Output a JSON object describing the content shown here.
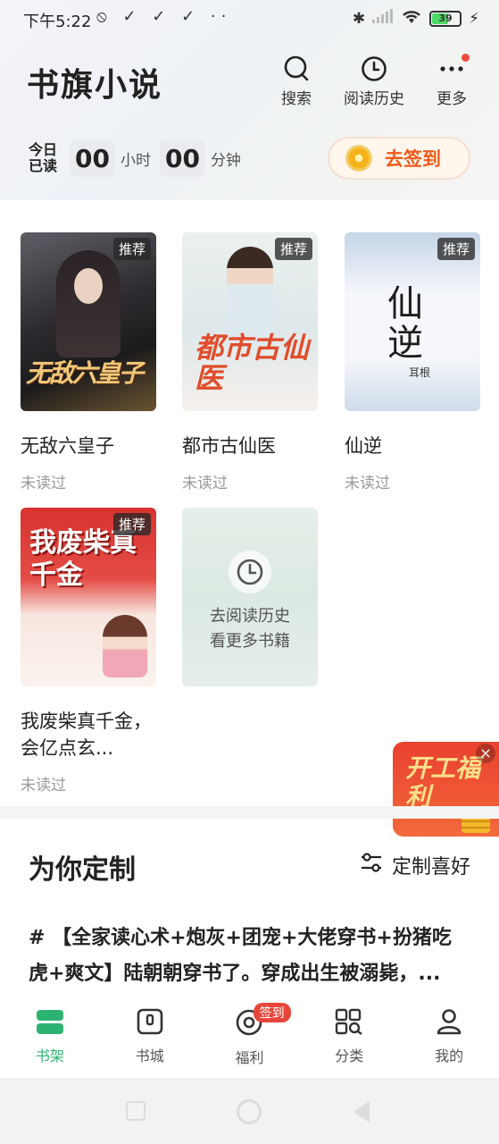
{
  "status_bar": {
    "time": "下午5:22",
    "left_icons": "⦸ ✓ ✓ ✓ ··",
    "battery": "39"
  },
  "header": {
    "app_title": "书旗小说",
    "actions": [
      {
        "label": "搜索",
        "icon": "search-icon"
      },
      {
        "label": "阅读历史",
        "icon": "clock-icon"
      },
      {
        "label": "更多",
        "icon": "more-icon"
      }
    ],
    "today_read": {
      "label": "今日已读",
      "hours": "00",
      "hours_unit": "小时",
      "minutes": "00",
      "minutes_unit": "分钟"
    },
    "checkin_label": "去签到"
  },
  "bookshelf": {
    "books": [
      {
        "title": "无敌六皇子",
        "status": "未读过",
        "badge": "推荐",
        "cover_text": "无敌六皇子"
      },
      {
        "title": "都市古仙医",
        "status": "未读过",
        "badge": "推荐",
        "cover_text": "都市古仙医"
      },
      {
        "title": "仙逆",
        "status": "未读过",
        "badge": "推荐",
        "cover_text": "仙逆",
        "cover_author": "耳根"
      },
      {
        "title": "我废柴真千金，会亿点玄...",
        "status": "未读过",
        "badge": "推荐",
        "cover_text": "我废柴真千金"
      }
    ],
    "history_card": {
      "line1": "去阅读历史",
      "line2": "看更多书籍"
    }
  },
  "promo": {
    "text": "开工福利"
  },
  "custom_section": {
    "title": "为你定制",
    "pref_label": "定制喜好",
    "recommendation": "# 【全家读心术+炮灰+团宠+大佬穿书+扮猪吃虎+爽文】陆朝朝穿书了。穿成出生被溺毙，..."
  },
  "tabbar": {
    "tabs": [
      {
        "label": "书架",
        "icon": "bookshelf-icon",
        "active": true
      },
      {
        "label": "书城",
        "icon": "bookstore-icon",
        "active": false
      },
      {
        "label": "福利",
        "icon": "welfare-icon",
        "active": false,
        "badge": "签到"
      },
      {
        "label": "分类",
        "icon": "category-icon",
        "active": false
      },
      {
        "label": "我的",
        "icon": "profile-icon",
        "active": false
      }
    ]
  },
  "colors": {
    "accent_green": "#2db371",
    "checkin_orange": "#ef5b1b",
    "badge_red": "#e8463b"
  }
}
